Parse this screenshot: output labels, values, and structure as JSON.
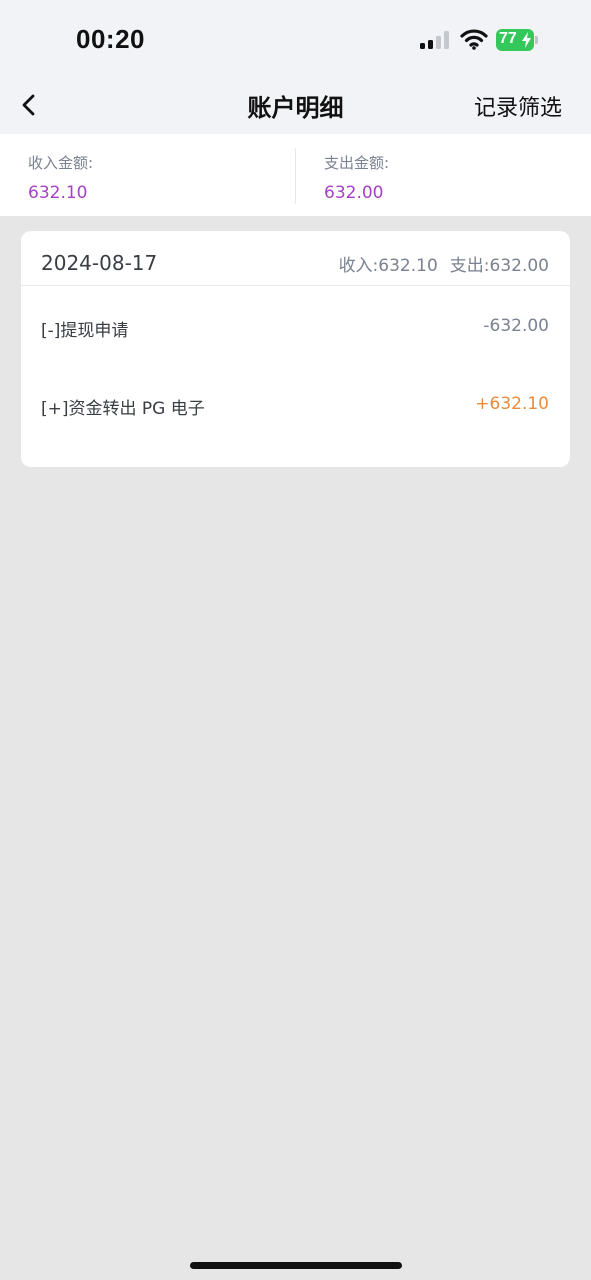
{
  "status_bar": {
    "time": "00:20",
    "battery": "77",
    "battery_color": "#34c759"
  },
  "nav": {
    "title": "账户明细",
    "right_label": "记录筛选",
    "back_icon": "chevron-left-icon"
  },
  "summary": {
    "income_label": "收入金额:",
    "income_value": "632.10",
    "expense_label": "支出金额:",
    "expense_value": "632.00",
    "value_color": "#a640c8"
  },
  "records": [
    {
      "date": "2024-08-17",
      "income_total": "收入:632.10",
      "expense_total": "支出:632.00",
      "items": [
        {
          "label": "[-]提现申请",
          "amount": "-632.00",
          "color": "#7a8190"
        },
        {
          "label": "[+]资金转出 PG 电子",
          "amount": "+632.10",
          "color": "#e88b3c"
        }
      ]
    }
  ]
}
